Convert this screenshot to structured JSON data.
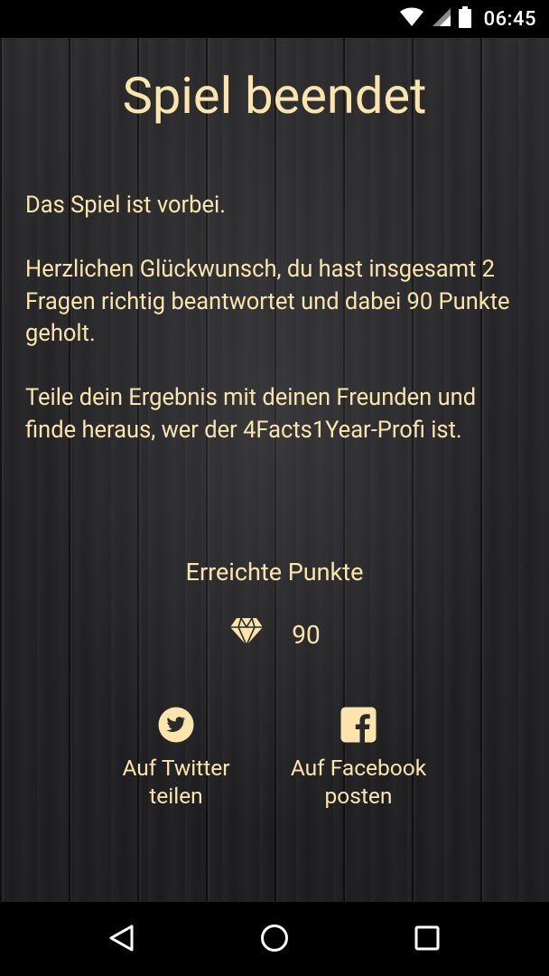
{
  "status_bar": {
    "time": "06:45",
    "icons": [
      "wifi-icon",
      "cell-signal-icon",
      "battery-icon"
    ]
  },
  "screen": {
    "title": "Spiel beendet",
    "paragraphs": [
      "Das Spiel ist vorbei.",
      "Herzlichen Glückwunsch, du hast insgesamt 2 Fragen richtig beantwortet und dabei 90 Punkte geholt.",
      "Teile dein Ergebnis mit deinen Freunden und finde heraus, wer der 4Facts1Year-Profi ist."
    ],
    "score": {
      "label": "Erreichte Punkte",
      "icon": "diamond-icon",
      "value": "90"
    },
    "share": {
      "twitter": {
        "icon": "twitter-icon",
        "line1": "Auf Twitter",
        "line2": "teilen"
      },
      "facebook": {
        "icon": "facebook-icon",
        "line1": "Auf Facebook",
        "line2": "posten"
      }
    }
  },
  "nav_bar": {
    "buttons": [
      "back-icon",
      "home-icon",
      "recents-icon"
    ]
  },
  "colors": {
    "accent": "#fbe5ac",
    "background": "#2a2a2c",
    "system_bar": "#000000"
  }
}
